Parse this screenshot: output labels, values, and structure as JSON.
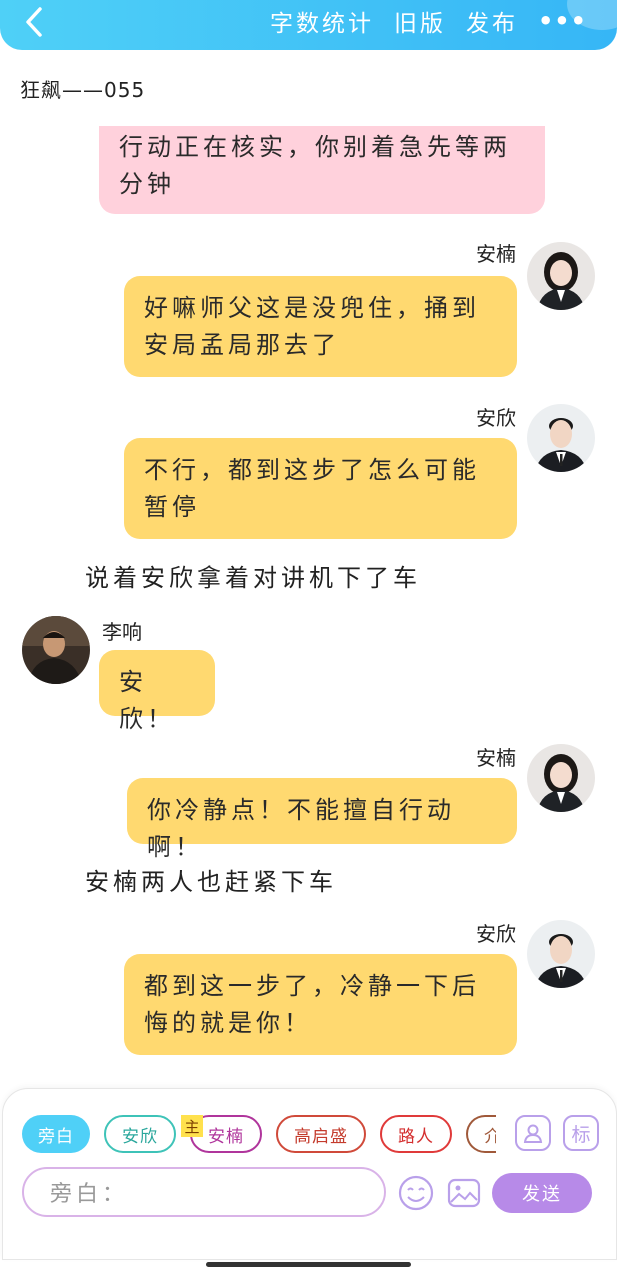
{
  "header": {
    "actions": [
      "字数统计",
      "旧版",
      "发布"
    ],
    "accent": "#36b6f6"
  },
  "story_title": "狂飙——055",
  "messages": [
    {
      "type": "bubble",
      "style": "pink",
      "text": "行动正在核实，你别着急先等两分钟"
    },
    {
      "type": "bubble",
      "style": "yellow",
      "side": "right",
      "speaker": "安楠",
      "text": "好嘛师父这是没兜住，捅到安局孟局那去了"
    },
    {
      "type": "bubble",
      "style": "yellow",
      "side": "right",
      "speaker": "安欣",
      "text": "不行，都到这步了怎么可能暂停"
    },
    {
      "type": "narration",
      "text": "说着安欣拿着对讲机下了车"
    },
    {
      "type": "bubble",
      "style": "yellow",
      "side": "left",
      "speaker": "李响",
      "text": "安欣！"
    },
    {
      "type": "bubble",
      "style": "yellow",
      "side": "right",
      "speaker": "安楠",
      "text": "你冷静点！不能擅自行动啊！"
    },
    {
      "type": "narration",
      "text": "安楠两人也赶紧下车"
    },
    {
      "type": "bubble",
      "style": "yellow",
      "side": "right",
      "speaker": "安欣",
      "text": "都到这一步了，冷静一下后悔的就是你！"
    }
  ],
  "composer": {
    "roles": [
      {
        "label": "旁白",
        "selected": true
      },
      {
        "label": "安欣"
      },
      {
        "label": "安楠",
        "badge": "主"
      },
      {
        "label": "高启盛"
      },
      {
        "label": "路人"
      },
      {
        "label": "介"
      }
    ],
    "tools": [
      "添加角色",
      "标"
    ],
    "input_placeholder": "旁白：",
    "send_label": "发送"
  }
}
